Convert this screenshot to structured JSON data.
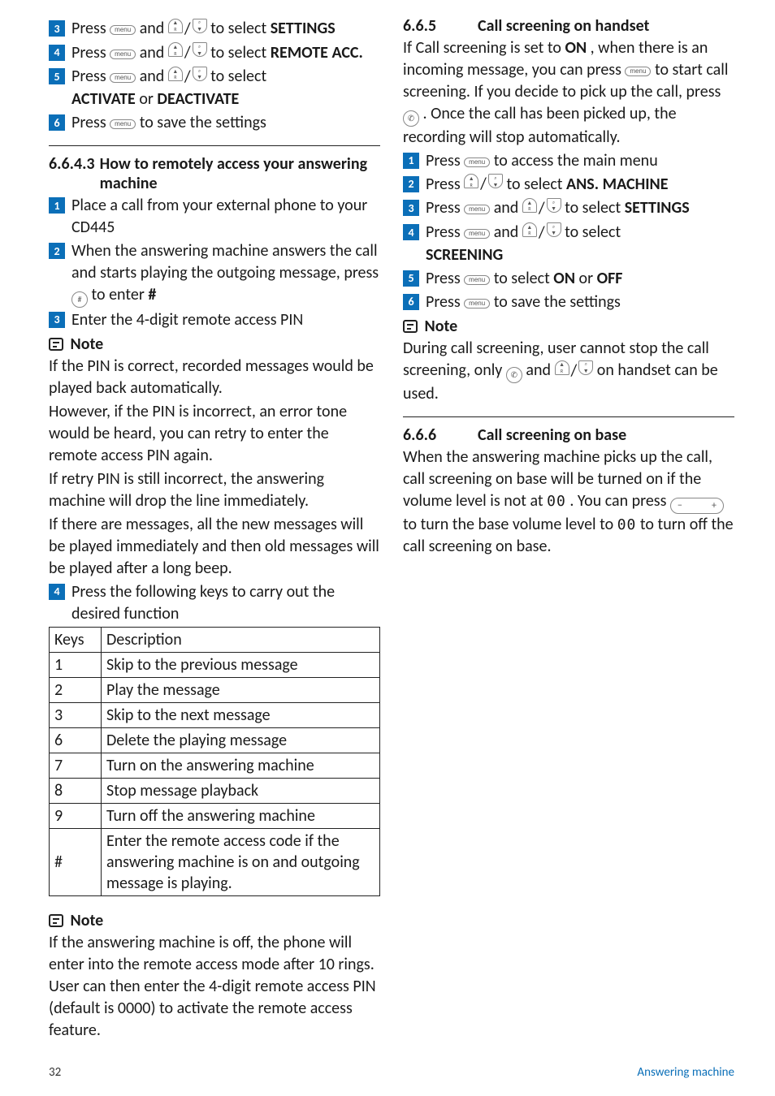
{
  "left": {
    "s3": {
      "pre": "Press ",
      "mid": " and ",
      "post": " to select ",
      "target": "SETTINGS"
    },
    "s4": {
      "pre": "Press ",
      "mid": " and ",
      "post": " to select ",
      "target": "REMOTE ACC."
    },
    "s5": {
      "pre": "Press ",
      "mid": " and ",
      "post": " to select",
      "target": "ACTIVATE",
      "or": " or ",
      "target2": "DEACTIVATE"
    },
    "s6": {
      "pre": "Press ",
      "post": " to save the settings"
    },
    "sec6643": {
      "num": "6.6.4.3",
      "title": "How to remotely access your answering machine"
    },
    "r1": "Place a call from your external phone to your CD445",
    "r2": {
      "a": "When the answering machine answers the call and starts playing the outgoing message, press ",
      "b": " to enter ",
      "c": "#"
    },
    "r3": "Enter the 4-digit remote access PIN",
    "note": "Note",
    "p1": "If the PIN is correct, recorded messages would be played back automatically.",
    "p2": "However, if the PIN is incorrect, an error tone would be heard, you can retry to enter the remote access PIN again.",
    "p3": "If retry PIN is still incorrect, the answering machine will drop the line immediately.",
    "p4": "If there are messages, all the new messages will be played immediately and then old messages will be played after a long beep.",
    "r4": "Press the following keys to carry out the desired function",
    "th": {
      "k": "Keys",
      "d": "Description"
    },
    "rows": [
      {
        "k": "1",
        "d": "Skip to the previous message"
      },
      {
        "k": "2",
        "d": "Play the message"
      },
      {
        "k": "3",
        "d": "Skip to the next message"
      },
      {
        "k": "6",
        "d": "Delete the playing message"
      },
      {
        "k": "7",
        "d": "Turn on the answering machine"
      },
      {
        "k": "8",
        "d": "Stop message playback"
      },
      {
        "k": "9",
        "d": "Turn off the answering machine"
      },
      {
        "k": "#",
        "d": "Enter the remote access code if the answering machine is on and outgoing message is playing."
      }
    ],
    "note2": "Note",
    "p5": "If the answering machine is off, the phone will enter into the remote access mode after 10 rings. User can then enter the 4-digit remote access PIN (default is 0000) to activate the remote access feature."
  },
  "right": {
    "sec665": {
      "num": "6.6.5",
      "title": "Call screening on handset"
    },
    "intro1a": "If Call screening is set to ",
    "intro1on": "ON",
    "intro1b": ", when there is an incoming message, you can press ",
    "intro1c": " to start call screening. If you decide to pick up the call, press ",
    "intro1d": ". Once the call has been picked up, the recording will stop automatically.",
    "h1": {
      "pre": "Press ",
      "post": " to access the main menu"
    },
    "h2": {
      "pre": "Press ",
      "post": " to select ",
      "t": "ANS. MACHINE"
    },
    "h3": {
      "pre": "Press ",
      "mid": " and ",
      "post": " to select ",
      "t": "SETTINGS"
    },
    "h4": {
      "pre": "Press ",
      "mid": " and ",
      "post": " to select",
      "t": "SCREENING"
    },
    "h5": {
      "pre": "Press ",
      "post": " to select ",
      "t1": "ON",
      "or": " or ",
      "t2": "OFF"
    },
    "h6": {
      "pre": "Press ",
      "post": " to save the settings"
    },
    "note": "Note",
    "np": {
      "a": "During call screening, user cannot stop the call screening, only ",
      "b": " and ",
      "c": " on handset can be used."
    },
    "sec666": {
      "num": "6.6.6",
      "title": "Call screening on base"
    },
    "p1": "When the answering machine picks up the call, call screening on base will be turned on if the volume level is not at ",
    "vol": "00",
    "p1b": ". You can press ",
    "p2a": " to turn the base volume level to ",
    "p2b": " to turn off the call screening on base."
  },
  "footer": {
    "page": "32",
    "label": "Answering machine"
  }
}
